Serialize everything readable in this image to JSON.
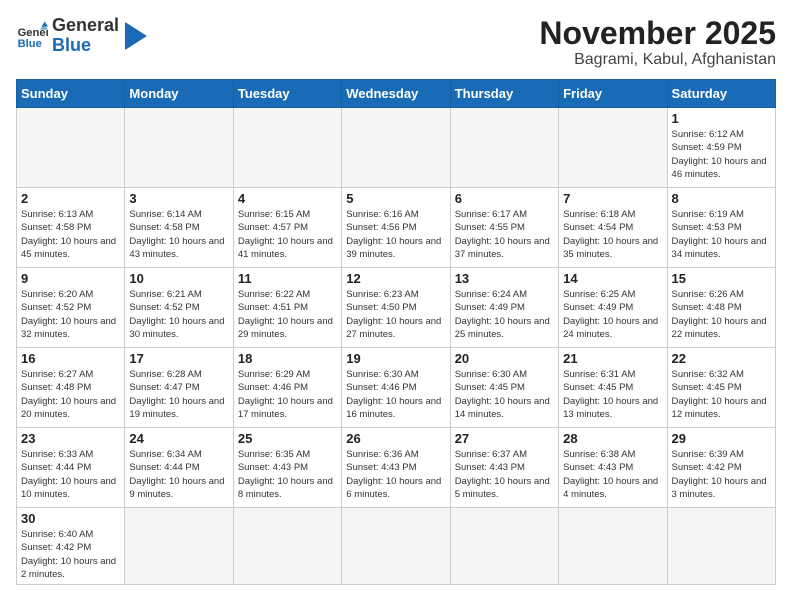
{
  "logo": {
    "text_general": "General",
    "text_blue": "Blue"
  },
  "title": {
    "month_year": "November 2025",
    "location": "Bagrami, Kabul, Afghanistan"
  },
  "weekdays": [
    "Sunday",
    "Monday",
    "Tuesday",
    "Wednesday",
    "Thursday",
    "Friday",
    "Saturday"
  ],
  "days": [
    {
      "day": "",
      "info": ""
    },
    {
      "day": "",
      "info": ""
    },
    {
      "day": "",
      "info": ""
    },
    {
      "day": "",
      "info": ""
    },
    {
      "day": "",
      "info": ""
    },
    {
      "day": "",
      "info": ""
    },
    {
      "day": "1",
      "info": "Sunrise: 6:12 AM\nSunset: 4:59 PM\nDaylight: 10 hours and 46 minutes."
    },
    {
      "day": "2",
      "info": "Sunrise: 6:13 AM\nSunset: 4:58 PM\nDaylight: 10 hours and 45 minutes."
    },
    {
      "day": "3",
      "info": "Sunrise: 6:14 AM\nSunset: 4:58 PM\nDaylight: 10 hours and 43 minutes."
    },
    {
      "day": "4",
      "info": "Sunrise: 6:15 AM\nSunset: 4:57 PM\nDaylight: 10 hours and 41 minutes."
    },
    {
      "day": "5",
      "info": "Sunrise: 6:16 AM\nSunset: 4:56 PM\nDaylight: 10 hours and 39 minutes."
    },
    {
      "day": "6",
      "info": "Sunrise: 6:17 AM\nSunset: 4:55 PM\nDaylight: 10 hours and 37 minutes."
    },
    {
      "day": "7",
      "info": "Sunrise: 6:18 AM\nSunset: 4:54 PM\nDaylight: 10 hours and 35 minutes."
    },
    {
      "day": "8",
      "info": "Sunrise: 6:19 AM\nSunset: 4:53 PM\nDaylight: 10 hours and 34 minutes."
    },
    {
      "day": "9",
      "info": "Sunrise: 6:20 AM\nSunset: 4:52 PM\nDaylight: 10 hours and 32 minutes."
    },
    {
      "day": "10",
      "info": "Sunrise: 6:21 AM\nSunset: 4:52 PM\nDaylight: 10 hours and 30 minutes."
    },
    {
      "day": "11",
      "info": "Sunrise: 6:22 AM\nSunset: 4:51 PM\nDaylight: 10 hours and 29 minutes."
    },
    {
      "day": "12",
      "info": "Sunrise: 6:23 AM\nSunset: 4:50 PM\nDaylight: 10 hours and 27 minutes."
    },
    {
      "day": "13",
      "info": "Sunrise: 6:24 AM\nSunset: 4:49 PM\nDaylight: 10 hours and 25 minutes."
    },
    {
      "day": "14",
      "info": "Sunrise: 6:25 AM\nSunset: 4:49 PM\nDaylight: 10 hours and 24 minutes."
    },
    {
      "day": "15",
      "info": "Sunrise: 6:26 AM\nSunset: 4:48 PM\nDaylight: 10 hours and 22 minutes."
    },
    {
      "day": "16",
      "info": "Sunrise: 6:27 AM\nSunset: 4:48 PM\nDaylight: 10 hours and 20 minutes."
    },
    {
      "day": "17",
      "info": "Sunrise: 6:28 AM\nSunset: 4:47 PM\nDaylight: 10 hours and 19 minutes."
    },
    {
      "day": "18",
      "info": "Sunrise: 6:29 AM\nSunset: 4:46 PM\nDaylight: 10 hours and 17 minutes."
    },
    {
      "day": "19",
      "info": "Sunrise: 6:30 AM\nSunset: 4:46 PM\nDaylight: 10 hours and 16 minutes."
    },
    {
      "day": "20",
      "info": "Sunrise: 6:30 AM\nSunset: 4:45 PM\nDaylight: 10 hours and 14 minutes."
    },
    {
      "day": "21",
      "info": "Sunrise: 6:31 AM\nSunset: 4:45 PM\nDaylight: 10 hours and 13 minutes."
    },
    {
      "day": "22",
      "info": "Sunrise: 6:32 AM\nSunset: 4:45 PM\nDaylight: 10 hours and 12 minutes."
    },
    {
      "day": "23",
      "info": "Sunrise: 6:33 AM\nSunset: 4:44 PM\nDaylight: 10 hours and 10 minutes."
    },
    {
      "day": "24",
      "info": "Sunrise: 6:34 AM\nSunset: 4:44 PM\nDaylight: 10 hours and 9 minutes."
    },
    {
      "day": "25",
      "info": "Sunrise: 6:35 AM\nSunset: 4:43 PM\nDaylight: 10 hours and 8 minutes."
    },
    {
      "day": "26",
      "info": "Sunrise: 6:36 AM\nSunset: 4:43 PM\nDaylight: 10 hours and 6 minutes."
    },
    {
      "day": "27",
      "info": "Sunrise: 6:37 AM\nSunset: 4:43 PM\nDaylight: 10 hours and 5 minutes."
    },
    {
      "day": "28",
      "info": "Sunrise: 6:38 AM\nSunset: 4:43 PM\nDaylight: 10 hours and 4 minutes."
    },
    {
      "day": "29",
      "info": "Sunrise: 6:39 AM\nSunset: 4:42 PM\nDaylight: 10 hours and 3 minutes."
    },
    {
      "day": "30",
      "info": "Sunrise: 6:40 AM\nSunset: 4:42 PM\nDaylight: 10 hours and 2 minutes."
    },
    {
      "day": "",
      "info": ""
    },
    {
      "day": "",
      "info": ""
    },
    {
      "day": "",
      "info": ""
    },
    {
      "day": "",
      "info": ""
    },
    {
      "day": "",
      "info": ""
    },
    {
      "day": "",
      "info": ""
    }
  ]
}
